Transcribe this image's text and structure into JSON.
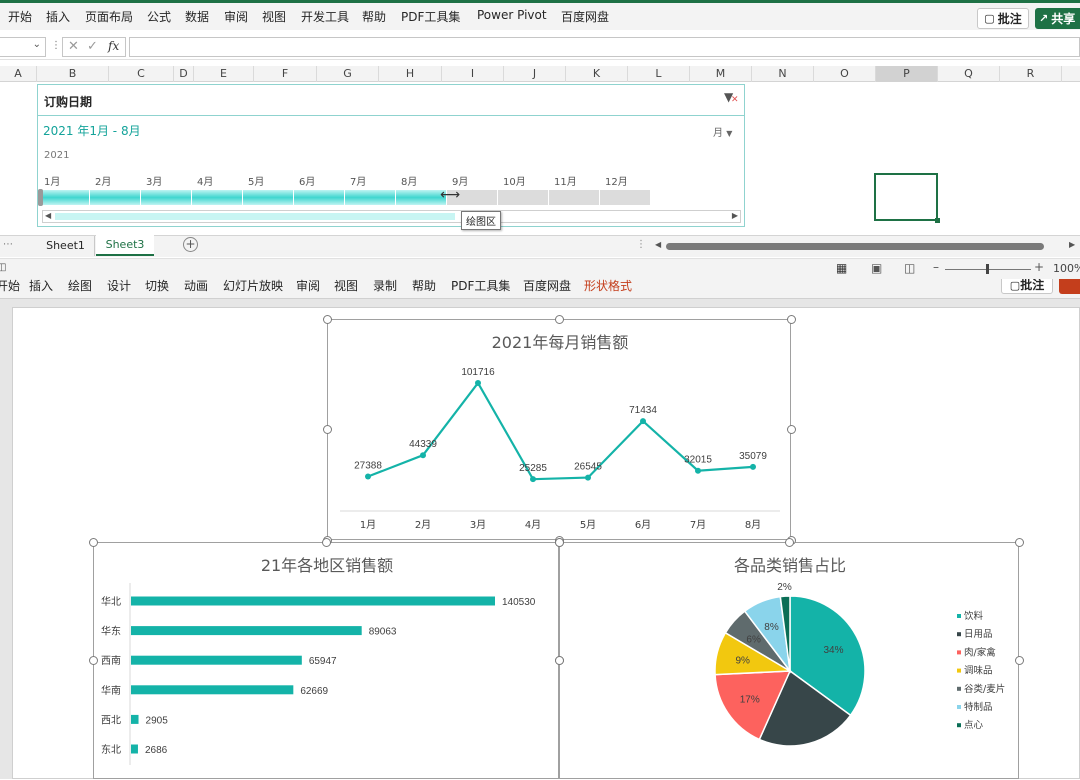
{
  "excel": {
    "ribbon_tabs": [
      "开始",
      "插入",
      "页面布局",
      "公式",
      "数据",
      "审阅",
      "视图",
      "开发工具",
      "帮助",
      "PDF工具集",
      "Power Pivot",
      "百度网盘"
    ],
    "comment_label": "批注",
    "share_label": "共享",
    "fx_label": "fx",
    "columns": [
      "A",
      "B",
      "C",
      "D",
      "E",
      "F",
      "G",
      "H",
      "I",
      "J",
      "K",
      "L",
      "M",
      "N",
      "O",
      "P",
      "Q",
      "R"
    ],
    "slicer": {
      "title": "订购日期",
      "range_label": "2021 年1月 - 8月",
      "level_label": "月",
      "year_label": "2021",
      "months": [
        "1月",
        "2月",
        "3月",
        "4月",
        "5月",
        "6月",
        "7月",
        "8月",
        "9月",
        "10月",
        "11月",
        "12月"
      ],
      "selected_fraction": 0.667,
      "tooltip": "绘图区"
    },
    "sheet_tabs": [
      "Sheet1",
      "Sheet3"
    ],
    "active_sheet": "Sheet3",
    "zoom": "100%"
  },
  "ppt": {
    "ribbon_tabs": [
      "开始",
      "插入",
      "绘图",
      "设计",
      "切换",
      "动画",
      "幻灯片放映",
      "审阅",
      "视图",
      "录制",
      "帮助",
      "PDF工具集",
      "百度网盘",
      "形状格式"
    ],
    "comment_label": "批注"
  },
  "chart_data": [
    {
      "type": "line",
      "title": "2021年每月销售额",
      "categories": [
        "1月",
        "2月",
        "3月",
        "4月",
        "5月",
        "6月",
        "7月",
        "8月"
      ],
      "values": [
        27388,
        44339,
        101716,
        25285,
        26545,
        71434,
        32015,
        35079
      ],
      "color": "#14b3a8",
      "ylim": [
        0,
        120000
      ]
    },
    {
      "type": "bar",
      "orientation": "horizontal",
      "title": "21年各地区销售额",
      "categories": [
        "华北",
        "华东",
        "西南",
        "华南",
        "西北",
        "东北"
      ],
      "values": [
        140530,
        89063,
        65947,
        62669,
        2905,
        2686
      ],
      "color": "#14b3a8"
    },
    {
      "type": "pie",
      "title": "各品类销售占比",
      "categories": [
        "饮料",
        "日用品",
        "肉/家禽",
        "调味品",
        "谷类/麦片",
        "特制品",
        "点心"
      ],
      "values": [
        34,
        21,
        17,
        9,
        6,
        8,
        2
      ],
      "labels": [
        "34%",
        "",
        "17%",
        "9%",
        "6%",
        "8%",
        "2%"
      ],
      "colors": [
        "#14b3a8",
        "#374649",
        "#fd625e",
        "#f2c80f",
        "#5f6b6d",
        "#8ad4eb",
        "#0a6e56"
      ]
    }
  ]
}
